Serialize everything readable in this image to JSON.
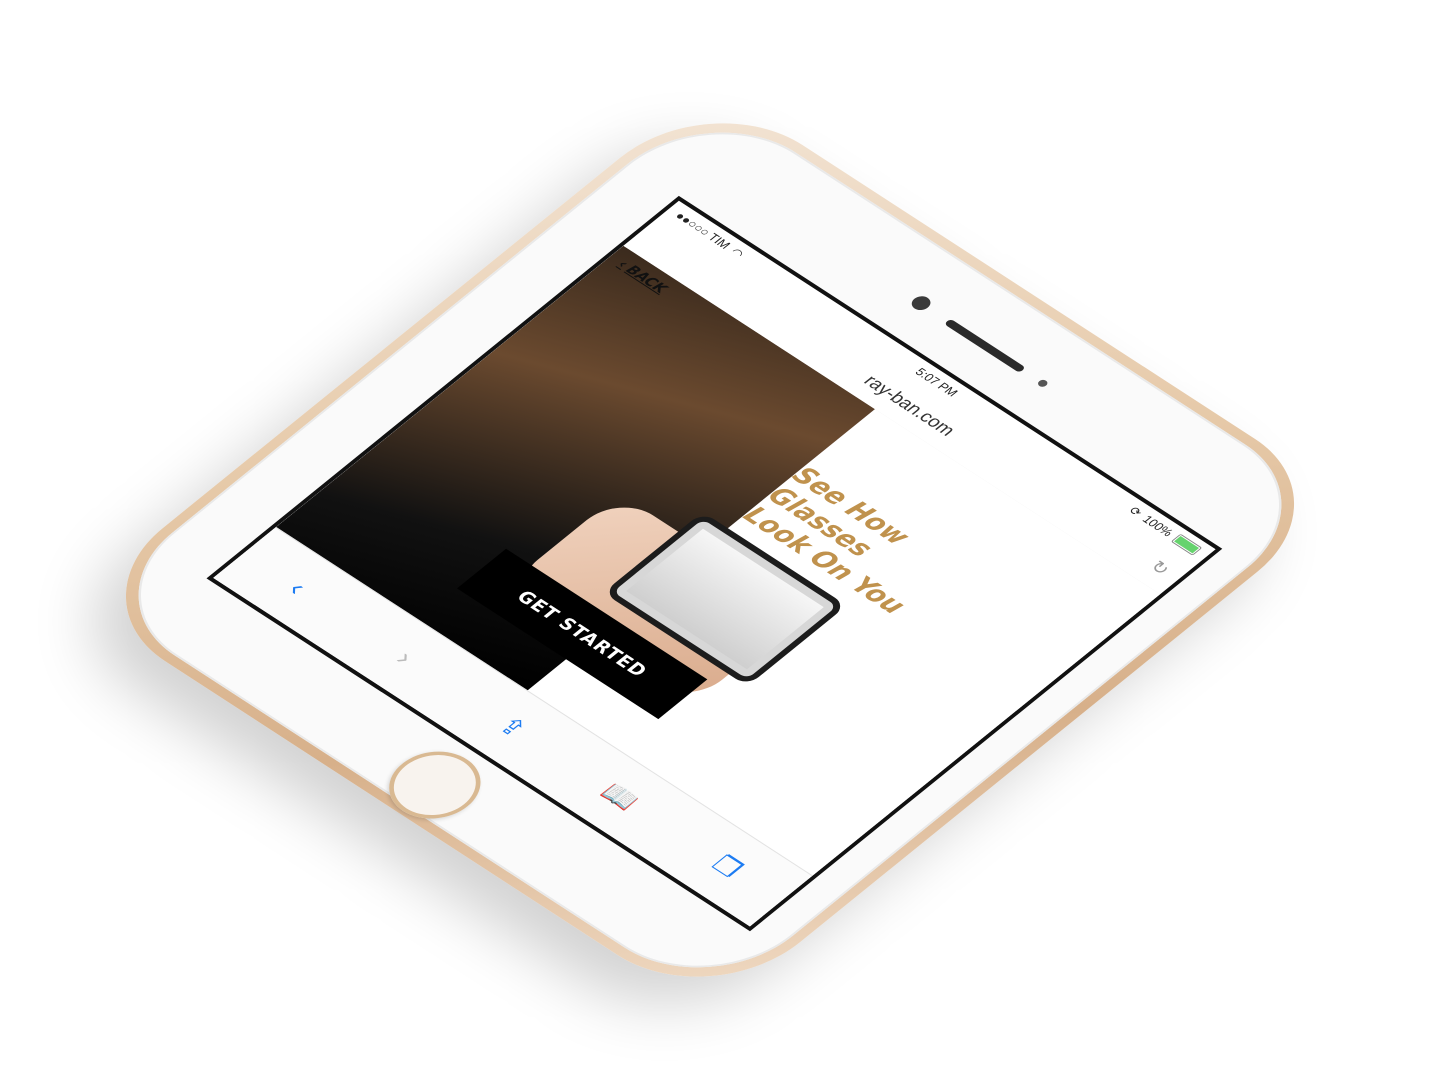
{
  "status_bar": {
    "carrier": "●●○○○ TIM",
    "time": "5:07 PM",
    "battery": "100%"
  },
  "address_bar": {
    "url": "ray-ban.com"
  },
  "page": {
    "back_label": "BACK",
    "headline_line1": "See How Glasses",
    "headline_line2": "Look On You",
    "cta_label": "GET STARTED"
  },
  "toolbar": {
    "back_icon": "chevron-left-icon",
    "forward_icon": "chevron-right-icon",
    "share_icon": "share-icon",
    "bookmarks_icon": "bookmarks-icon",
    "tabs_icon": "tabs-icon"
  },
  "colors": {
    "accent": "#c0924d",
    "phone_gold": "#e6c9a8",
    "ios_blue": "#1d7cf2"
  }
}
